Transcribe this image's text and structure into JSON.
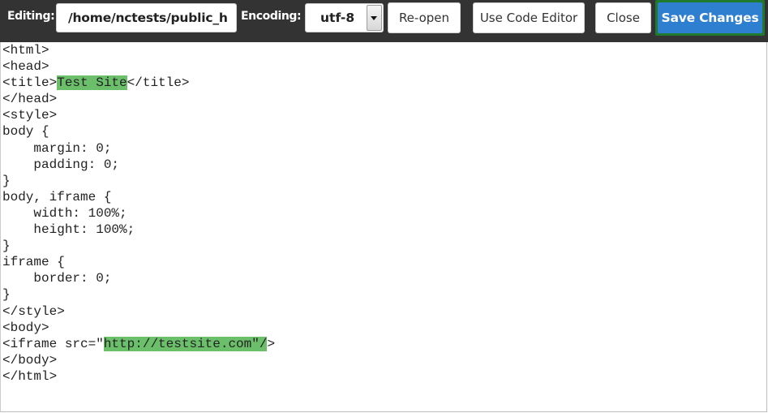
{
  "toolbar": {
    "editing_label": "Editing:",
    "path_value": "/home/nctests/public_h",
    "encoding_label": "Encoding:",
    "encoding_value": "utf-8",
    "reopen_label": "Re-open",
    "code_editor_label": "Use Code Editor",
    "close_label": "Close",
    "save_label": "Save Changes"
  },
  "editor": {
    "lines": [
      {
        "pre": "<html>",
        "hl": "",
        "post": ""
      },
      {
        "pre": "<head>",
        "hl": "",
        "post": ""
      },
      {
        "pre": "<title>",
        "hl": "Test Site",
        "post": "</title>"
      },
      {
        "pre": "</head>",
        "hl": "",
        "post": ""
      },
      {
        "pre": "<style>",
        "hl": "",
        "post": ""
      },
      {
        "pre": "body {",
        "hl": "",
        "post": ""
      },
      {
        "pre": "    margin: 0;",
        "hl": "",
        "post": ""
      },
      {
        "pre": "    padding: 0;",
        "hl": "",
        "post": ""
      },
      {
        "pre": "}",
        "hl": "",
        "post": ""
      },
      {
        "pre": "body, iframe {",
        "hl": "",
        "post": ""
      },
      {
        "pre": "    width: 100%;",
        "hl": "",
        "post": ""
      },
      {
        "pre": "    height: 100%;",
        "hl": "",
        "post": ""
      },
      {
        "pre": "}",
        "hl": "",
        "post": ""
      },
      {
        "pre": "iframe {",
        "hl": "",
        "post": ""
      },
      {
        "pre": "    border: 0;",
        "hl": "",
        "post": ""
      },
      {
        "pre": "}",
        "hl": "",
        "post": ""
      },
      {
        "pre": "</style>",
        "hl": "",
        "post": ""
      },
      {
        "pre": "<body>",
        "hl": "",
        "post": ""
      },
      {
        "pre": "<iframe src=\"",
        "hl": "http://testsite.com\"/",
        "post": ">"
      },
      {
        "pre": "</body>",
        "hl": "",
        "post": ""
      },
      {
        "pre": "</html>",
        "hl": "",
        "post": ""
      }
    ]
  },
  "colors": {
    "toolbar_bg": "#333333",
    "save_button": "#2f7fd1",
    "save_button_outline": "#1f7a2e",
    "highlight": "#6bbf6b"
  }
}
